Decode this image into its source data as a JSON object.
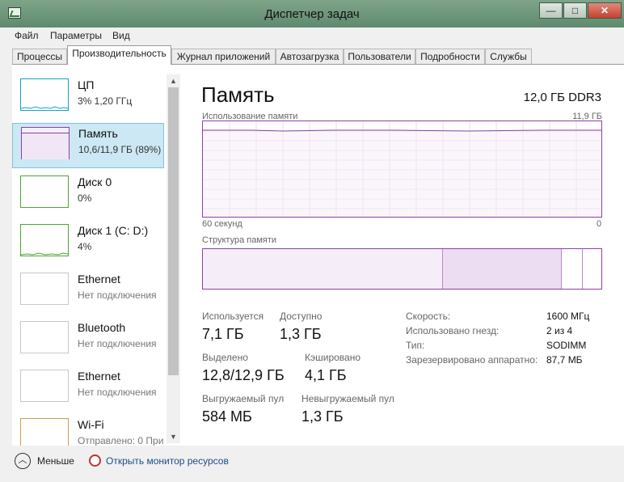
{
  "window": {
    "title": "Диспетчер задач",
    "minimize": "—",
    "maximize": "□",
    "close": "✕"
  },
  "menu": [
    "Файл",
    "Параметры",
    "Вид"
  ],
  "tabs": [
    "Процессы",
    "Производительность",
    "Журнал приложений",
    "Автозагрузка",
    "Пользователи",
    "Подробности",
    "Службы"
  ],
  "active_tab": "Производительность",
  "sidebar": [
    {
      "title": "ЦП",
      "subtitle": "3%  1,20 ГГц",
      "color": "#17a2c8"
    },
    {
      "title": "Память",
      "subtitle": "10,6/11,9 ГБ (89%)",
      "color": "#8e3fa8",
      "selected": true
    },
    {
      "title": "Диск 0",
      "subtitle": "0%",
      "color": "#4aa832"
    },
    {
      "title": "Диск 1 (C: D:)",
      "subtitle": "4%",
      "color": "#4aa832"
    },
    {
      "title": "Ethernet",
      "subtitle": "Нет подключения",
      "color": "#c8c8c8"
    },
    {
      "title": "Bluetooth",
      "subtitle": "Нет подключения",
      "color": "#c8c8c8"
    },
    {
      "title": "Ethernet",
      "subtitle": "Нет подключения",
      "color": "#c8c8c8"
    },
    {
      "title": "Wi-Fi",
      "subtitle": "Отправлено: 0 Прин",
      "color": "#c8a040"
    }
  ],
  "main": {
    "title": "Память",
    "spec": "12,0 ГБ DDR3",
    "graph_label": "Использование памяти",
    "graph_max": "11,9 ГБ",
    "graph_time": "60 секунд",
    "graph_zero": "0",
    "structure_label": "Структура памяти",
    "accent": "#8e3fa8"
  },
  "stats": {
    "used_label": "Используется",
    "used_value": "7,1 ГБ",
    "avail_label": "Доступно",
    "avail_value": "1,3 ГБ",
    "committed_label": "Выделено",
    "committed_value": "12,8/12,9 ГБ",
    "cached_label": "Кэшировано",
    "cached_value": "4,1 ГБ",
    "paged_label": "Выгружаемый пул",
    "paged_value": "584 МБ",
    "nonpaged_label": "Невыгружаемый пул",
    "nonpaged_value": "1,3 ГБ"
  },
  "details": [
    {
      "label": "Скорость:",
      "value": "1600 МГц"
    },
    {
      "label": "Использовано гнезд:",
      "value": "2 из 4"
    },
    {
      "label": "Тип:",
      "value": "SODIMM"
    },
    {
      "label": "Зарезервировано аппаратно:",
      "value": "87,7 МБ"
    }
  ],
  "footer": {
    "less_label": "Меньше",
    "monitor_link": "Открыть монитор ресурсов"
  }
}
